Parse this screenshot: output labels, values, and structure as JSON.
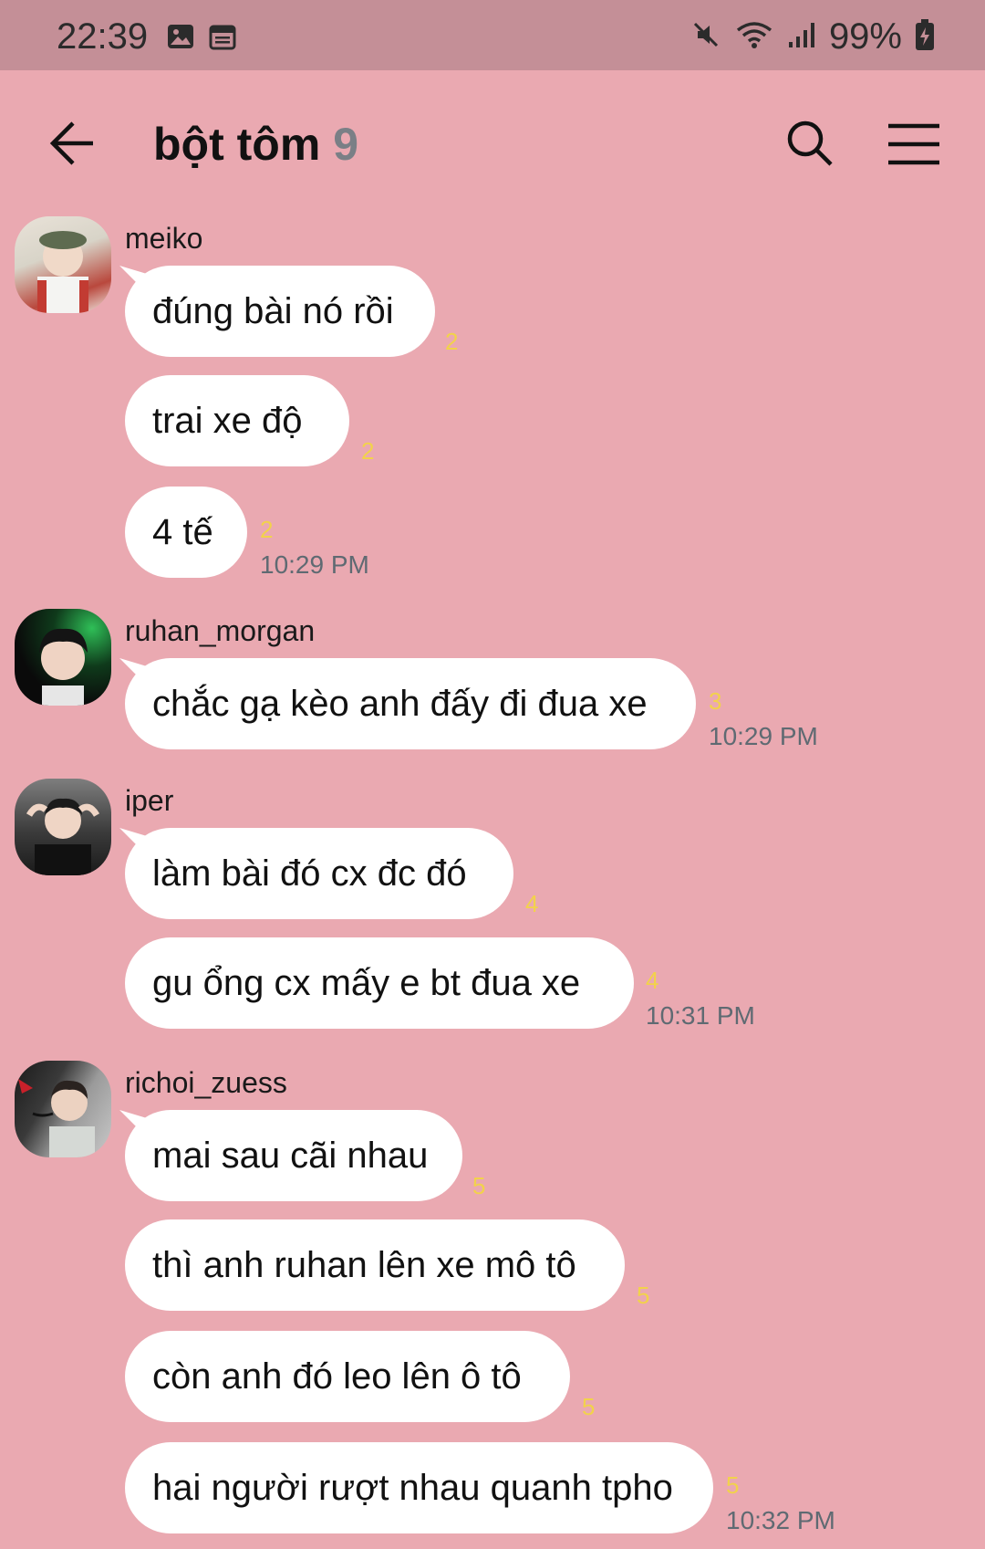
{
  "status_bar": {
    "time": "22:39",
    "battery": "99%",
    "icons_left": [
      "image-icon",
      "calendar-icon"
    ],
    "icons_right": [
      "mute-icon",
      "wifi-icon",
      "signal-icon",
      "battery-charging-icon"
    ]
  },
  "header": {
    "title": "bột tôm",
    "member_count": "9"
  },
  "colors": {
    "background": "#eaa9b1",
    "status_bar": "#c48f97",
    "bubble": "#ffffff",
    "unread": "#f2d24b",
    "time": "#5f6a72"
  },
  "messages": [
    {
      "sender": "meiko",
      "items": [
        {
          "text": "đúng bài nó rồi",
          "unread": "2"
        },
        {
          "text": "trai xe độ",
          "unread": "2"
        },
        {
          "text": "4 tế",
          "unread": "2",
          "time": "10:29 PM"
        }
      ]
    },
    {
      "sender": "ruhan_morgan",
      "items": [
        {
          "text": "chắc gạ kèo anh đấy đi đua xe",
          "unread": "3",
          "time": "10:29 PM"
        }
      ]
    },
    {
      "sender": "iper",
      "items": [
        {
          "text": "làm bài đó cx đc đó",
          "unread": "4"
        },
        {
          "text": "gu ổng cx mấy e bt đua xe",
          "unread": "4",
          "time": "10:31 PM"
        }
      ]
    },
    {
      "sender": "richoi_zuess",
      "items": [
        {
          "text": "mai sau cãi nhau",
          "unread": "5"
        },
        {
          "text": "thì anh ruhan lên xe mô tô",
          "unread": "5"
        },
        {
          "text": "còn anh đó leo lên ô tô",
          "unread": "5"
        },
        {
          "text": "hai người rượt nhau quanh tpho",
          "unread": "5",
          "time": "10:32 PM"
        }
      ]
    }
  ]
}
